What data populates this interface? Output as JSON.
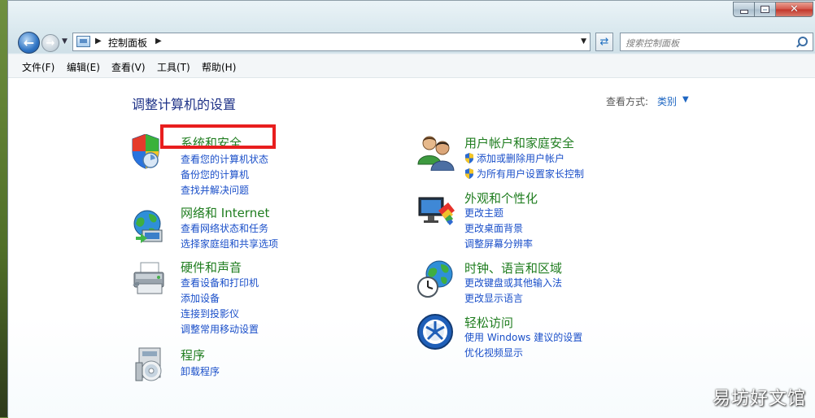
{
  "window": {
    "caption": {
      "minimize": "",
      "maximize": "",
      "close": "✕"
    }
  },
  "nav": {
    "address": "控制面板",
    "search_placeholder": "搜索控制面板"
  },
  "menu": [
    "文件(F)",
    "编辑(E)",
    "查看(V)",
    "工具(T)",
    "帮助(H)"
  ],
  "page_title": "调整计算机的设置",
  "view": {
    "label": "查看方式:",
    "value": "类别"
  },
  "categories": [
    {
      "title": "系统和安全",
      "icon": "shield-icon",
      "links": [
        "查看您的计算机状态",
        "备份您的计算机",
        "查找并解决问题"
      ]
    },
    {
      "title": "网络和 Internet",
      "icon": "network-globe-icon",
      "links": [
        "查看网络状态和任务",
        "选择家庭组和共享选项"
      ]
    },
    {
      "title": "硬件和声音",
      "icon": "printer-icon",
      "links": [
        "查看设备和打印机",
        "添加设备",
        "连接到投影仪",
        "调整常用移动设置"
      ]
    },
    {
      "title": "程序",
      "icon": "programs-icon",
      "links": [
        "卸载程序"
      ]
    },
    {
      "title": "用户帐户和家庭安全",
      "icon": "users-icon",
      "links": [
        "添加或删除用户帐户",
        "为所有用户设置家长控制"
      ]
    },
    {
      "title": "外观和个性化",
      "icon": "appearance-icon",
      "links": [
        "更改主题",
        "更改桌面背景",
        "调整屏幕分辨率"
      ]
    },
    {
      "title": "时钟、语言和区域",
      "icon": "clock-globe-icon",
      "links": [
        "更改键盘或其他输入法",
        "更改显示语言"
      ]
    },
    {
      "title": "轻松访问",
      "icon": "ease-of-access-icon",
      "links": [
        "使用 Windows 建议的设置",
        "优化视频显示"
      ]
    }
  ],
  "watermark": "易坊好文馆",
  "colors": {
    "category_title": "#1f7d1f",
    "link": "#1a4fc9",
    "title": "#1e3287",
    "highlight": "#e81e1e"
  }
}
